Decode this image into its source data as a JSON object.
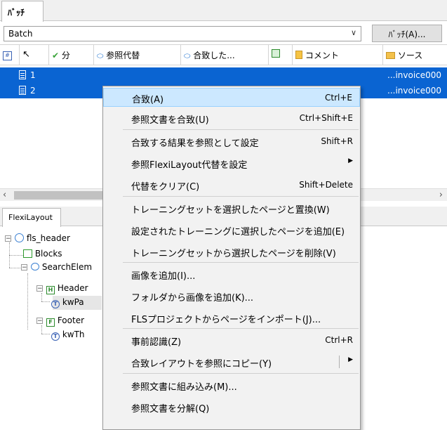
{
  "top_tab": "ﾊﾞｯﾁ",
  "batch_combo": {
    "value": "Batch"
  },
  "batch_button": "ﾊﾞｯﾁ(A)...",
  "columns": [
    "",
    "分",
    "参照代替",
    "合致した...",
    "",
    "コメント",
    "ソース"
  ],
  "rows": [
    {
      "num": "1",
      "source": "...invoice000"
    },
    {
      "num": "2",
      "source": "...invoice000"
    }
  ],
  "lower_tab": "FlexiLayout",
  "tree": {
    "root": "fls_header",
    "blocks": "Blocks",
    "search": "SearchElem",
    "header": "Header",
    "kwpa": "kwPa",
    "footer": "Footer",
    "kwth": "kwTh"
  },
  "menu": [
    {
      "label": "合致(A)",
      "shortcut": "Ctrl+E"
    },
    {
      "label": "参照文書を合致(U)",
      "shortcut": "Ctrl+Shift+E"
    },
    {
      "label": "合致する結果を参照として設定",
      "shortcut": "Shift+R"
    },
    {
      "label": "参照FlexiLayout代替を設定",
      "shortcut": ""
    },
    {
      "label": "代替をクリア(C)",
      "shortcut": "Shift+Delete"
    },
    {
      "label": "トレーニングセットを選択したページと置換(W)",
      "shortcut": ""
    },
    {
      "label": "設定されたトレーニングに選択したページを追加(E)",
      "shortcut": ""
    },
    {
      "label": "トレーニングセットから選択したページを削除(V)",
      "shortcut": ""
    },
    {
      "label": "画像を追加(I)...",
      "shortcut": ""
    },
    {
      "label": "フォルダから画像を追加(K)...",
      "shortcut": ""
    },
    {
      "label": "FLSプロジェクトからページをインポート(J)...",
      "shortcut": ""
    },
    {
      "label": "事前認識(Z)",
      "shortcut": "Ctrl+R"
    },
    {
      "label": "合致レイアウトを参照にコピー(Y)",
      "shortcut": ""
    },
    {
      "label": "参照文書に組み込み(M)...",
      "shortcut": ""
    },
    {
      "label": "参照文書を分解(Q)",
      "shortcut": ""
    }
  ],
  "colors": {
    "selection": "#0a64d2",
    "menu_highlight": "#cce8ff"
  }
}
